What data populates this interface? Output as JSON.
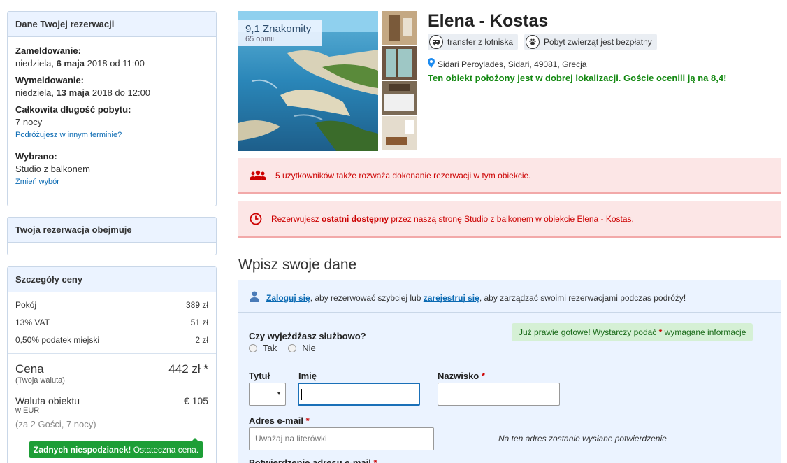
{
  "reservation": {
    "header": "Dane Twojej rezerwacji",
    "checkin_label": "Zameldowanie:",
    "checkin_day": "niedziela,",
    "checkin_date": "6 maja",
    "checkin_rest": "2018 od 11:00",
    "checkout_label": "Wymeldowanie:",
    "checkout_day": "niedziela,",
    "checkout_date": "13 maja",
    "checkout_rest": "2018 do 12:00",
    "length_label": "Całkowita długość pobytu:",
    "length_value": "7 nocy",
    "other_dates_link": "Podróżujesz w innym terminie?",
    "selected_label": "Wybrano:",
    "selected_value": "Studio z balkonem",
    "change_link": "Zmień wybór"
  },
  "includes": {
    "header": "Twoja rezerwacja obejmuje"
  },
  "price": {
    "header": "Szczegóły ceny",
    "rows": [
      {
        "label": "Pokój",
        "value": "389 zł"
      },
      {
        "label": "13% VAT",
        "value": "51 zł"
      },
      {
        "label": "0,50% podatek miejski",
        "value": "2 zł"
      }
    ],
    "total_label": "Cena",
    "total_value": "442 zł *",
    "total_sub": "(Twoja waluta)",
    "property_label": "Waluta obiektu",
    "property_value": "€ 105",
    "property_sub": "w EUR",
    "guests": "(za 2 Gości, 7 nocy)",
    "badge_bold": "Żadnych niespodzianek!",
    "badge_rest": " Ostateczna cena."
  },
  "hotel": {
    "score": "9,1 Znakomity",
    "reviews": "65 opinii",
    "name": "Elena - Kostas",
    "facility1": "transfer z lotniska",
    "facility2": "Pobyt zwierząt jest bezpłatny",
    "address": "Sidari Peroylades, Sidari, 49081, Grecja",
    "location_note": "Ten obiekt położony jest w dobrej lokalizacji. Goście ocenili ją na 8,4!"
  },
  "alerts": {
    "users": "5 użytkowników także rozważa dokonanie rezerwacji w tym obiekcie.",
    "last_prefix": "Rezerwujesz ",
    "last_bold": "ostatni dostępny",
    "last_rest": " przez naszą stronę Studio z balkonem w obiekcie Elena - Kostas."
  },
  "form": {
    "title": "Wpisz swoje dane",
    "login_link": "Zaloguj się",
    "login_mid": ", aby rezerwować szybciej lub ",
    "register_link": "zarejestruj się",
    "login_end": ", aby zarządzać swoimi rezerwacjami podczas podróży!",
    "business_q": "Czy wyjeżdżasz służbowo?",
    "yes": "Tak",
    "no": "Nie",
    "ready_text": "Już prawie gotowe! Wystarczy podać",
    "ready_star": "*",
    "ready_end": "wymagane informacje",
    "title_label": "Tytuł",
    "first_label": "Imię",
    "last_label": "Nazwisko",
    "req": "*",
    "email_label": "Adres e-mail",
    "email_placeholder": "Uważaj na literówki",
    "email_note": "Na ten adres zostanie wysłane potwierdzenie",
    "confirm_label": "Potwierdzenie adresu e-mail"
  },
  "colors": {
    "accent_blue": "#0a6ab3",
    "panel_bg": "#ebf3ff",
    "alert_red": "#c00000",
    "success_green": "#1d9e36"
  }
}
